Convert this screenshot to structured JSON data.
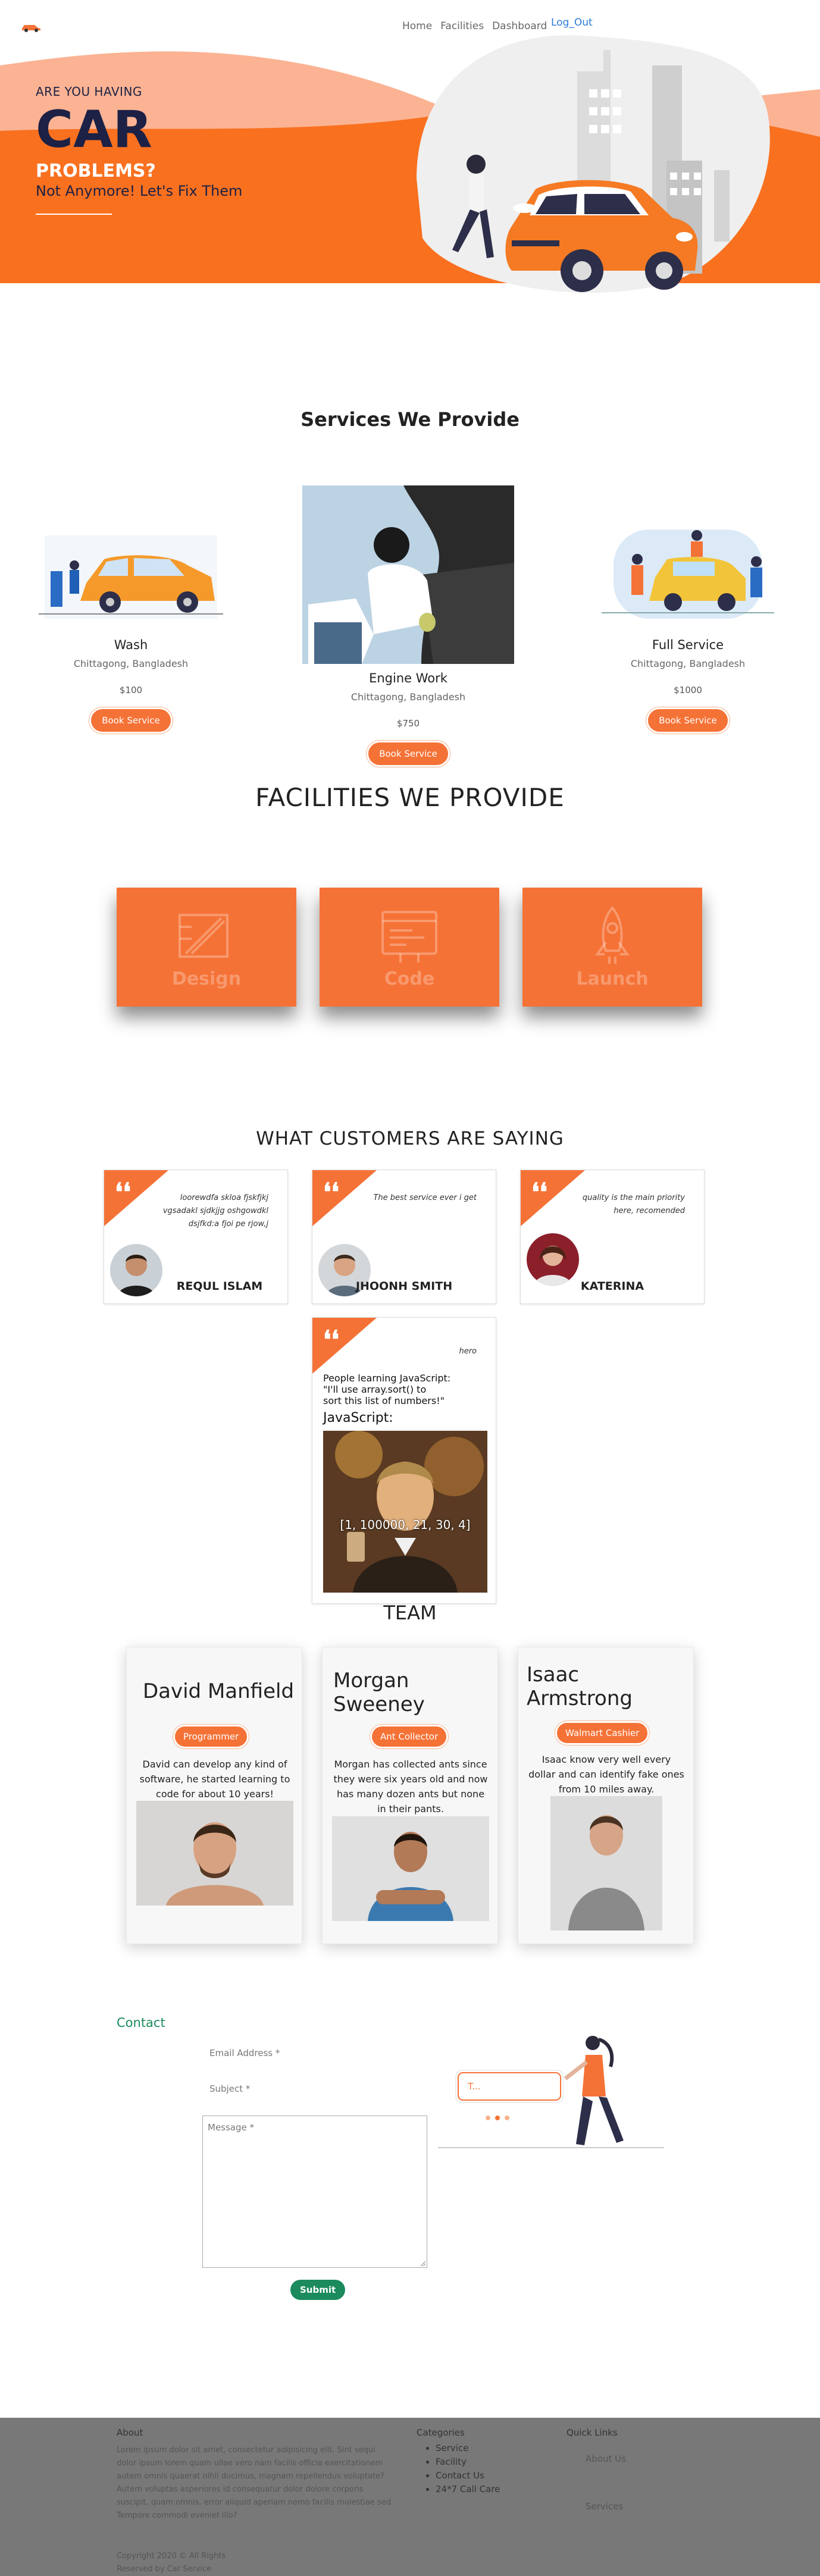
{
  "nav": {
    "links": [
      "Home",
      "Facilities",
      "Dashboard"
    ],
    "logout": "Log_Out"
  },
  "hero": {
    "kicker": "ARE YOU HAVING",
    "big": "CAR",
    "sub": "PROBLEMS?",
    "sub2": "Not Anymore! Let's Fix Them"
  },
  "services": {
    "title": "Services We Provide",
    "items": [
      {
        "name": "Wash",
        "location": "Chittagong, Bangladesh",
        "price": "$100",
        "button": "Book Service"
      },
      {
        "name": "Engine Work",
        "location": "Chittagong, Bangladesh",
        "price": "$750",
        "button": "Book Service"
      },
      {
        "name": "Full Service",
        "location": "Chittagong, Bangladesh",
        "price": "$1000",
        "button": "Book Service"
      }
    ]
  },
  "facilities": {
    "title": "FACILITIES WE PROVIDE",
    "items": [
      "Design",
      "Code",
      "Launch"
    ]
  },
  "testimonials": {
    "title": "WHAT CUSTOMERS ARE SAYING",
    "items": [
      {
        "text": "loorewdfa skloa fjskfjkj vgsadakl sjdkjjg oshgowdkl dsjfkd:a fjoi pe rjow,j",
        "name": "REQUL ISLAM"
      },
      {
        "text": "The best service ever i get",
        "name": "JHOONH SMITH"
      },
      {
        "text": "quality is the main priority here, recomended",
        "name": "KATERINA"
      },
      {
        "text": "hero",
        "name": ""
      }
    ],
    "meme": {
      "line1": "People learning JavaScript:",
      "line2": "\"I'll use array.sort() to",
      "line3": "sort this list of numbers!\"",
      "heading": "JavaScript:",
      "caption": "[1, 100000, 21, 30, 4]"
    }
  },
  "team": {
    "title": "TEAM",
    "members": [
      {
        "name": "David Manfield",
        "role": "Programmer",
        "bio": "David can develop any kind of software, he started learning to code for about 10 years!"
      },
      {
        "name": "Morgan Sweeney",
        "role": "Ant Collector",
        "bio": "Morgan has collected ants since they were six years old and now has many dozen ants but none in their pants."
      },
      {
        "name": "Isaac Armstrong",
        "role": "Walmart Cashier",
        "bio": "Isaac know very well every dollar and can identify fake ones from 10 miles away."
      }
    ]
  },
  "contact": {
    "title": "Contact",
    "email_label": "Email Address *",
    "subject_label": "Subject *",
    "message_label": "Message *",
    "submit": "Submit",
    "illustration_placeholder": "T..."
  },
  "footer": {
    "about_title": "About",
    "about_text": "Lorem ipsum dolor sit amet, consectetur adipisicing elit. Sint sequi dolor ipsum lorem quam ullae vero nam facilis officia exercitationem autem omnis quaerat nihil ducimus, magnam repellendus voluptate? Autem voluptas asperiores id consequatur dolor dolore corporis suscipit, quam omnis, error aliquid aperiam nemo facilis molestiae sed. Tempore commodi eveniet illo?",
    "copyright1": "Copyright 2020 © All Rights",
    "copyright2": "Reserved by Car Service",
    "categories_title": "Categories",
    "categories": [
      "Service",
      "Facility",
      "Contact Us",
      "24*7 Call Care"
    ],
    "quick_title": "Quick Links",
    "quick": [
      "About Us",
      "Services"
    ]
  },
  "colors": {
    "accent": "#f57236",
    "navy": "#1c2145",
    "green": "#1b8a5c",
    "link": "#2a7bd8"
  }
}
